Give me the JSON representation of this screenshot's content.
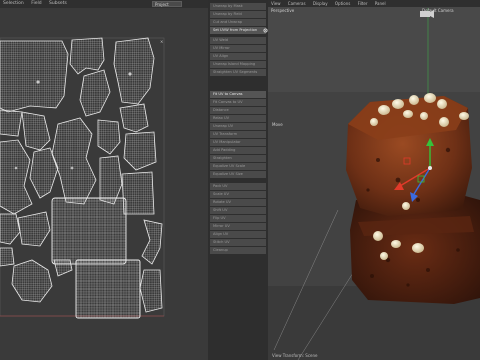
{
  "uv_editor": {
    "menu": [
      "Selection",
      "Field",
      "Subsets"
    ],
    "dropdown": "Project"
  },
  "commands": [
    {
      "label": "Unwrap by Mask",
      "state": "dim"
    },
    {
      "label": "Unwrap by Field",
      "state": "dim"
    },
    {
      "label": "Cut and Unwrap",
      "state": "dim"
    },
    {
      "label": "Set UVW from Projection",
      "state": "bright"
    },
    {
      "label": "UV Weld",
      "state": "dim"
    },
    {
      "label": "UV Mirror",
      "state": "dim"
    },
    {
      "label": "UV Align",
      "state": "dim"
    },
    {
      "label": "Unwrap Island Mapping",
      "state": "dim"
    },
    {
      "label": "Straighten UV Segments",
      "state": "dim"
    },
    {
      "label": "Fit UV to Canvas",
      "state": "bright"
    },
    {
      "label": "Fit Canvas to UV",
      "state": "dim"
    },
    {
      "label": "Distance",
      "state": "dim"
    },
    {
      "label": "Relax UV",
      "state": "dim"
    },
    {
      "label": "Unwrap UV",
      "state": "dim"
    },
    {
      "label": "UV Transform",
      "state": "dim"
    },
    {
      "label": "UV Manipulator",
      "state": "dim"
    },
    {
      "label": "Add Padding",
      "state": "dim"
    },
    {
      "label": "Straighten",
      "state": "dim"
    },
    {
      "label": "Equalize UV Scale",
      "state": "dim"
    },
    {
      "label": "Equalize UV Size",
      "state": "dim"
    },
    {
      "label": "Pack UV",
      "state": "dim"
    },
    {
      "label": "Scale UV",
      "state": "dim"
    },
    {
      "label": "Rotate UV",
      "state": "dim"
    },
    {
      "label": "Shift UV",
      "state": "dim"
    },
    {
      "label": "Flip UV",
      "state": "dim"
    },
    {
      "label": "Mirror UV",
      "state": "dim"
    },
    {
      "label": "Align UV",
      "state": "dim"
    },
    {
      "label": "Stitch UV",
      "state": "dim"
    },
    {
      "label": "Cleanup",
      "state": "dim"
    }
  ],
  "viewport": {
    "menu": [
      "View",
      "Cameras",
      "Display",
      "Options",
      "Filter",
      "Panel"
    ],
    "view_name": "Perspective",
    "camera": "Default Camera",
    "tool": "Move",
    "footer": "View Transform: Scene"
  },
  "colors": {
    "uv_bg": "#3a3a3a",
    "island_stroke": "#e4e4e4",
    "viewport_bg": "#484848",
    "brownie": "#7a3a1c",
    "axis_x": "#e23a2a",
    "axis_y": "#36c23a",
    "axis_z": "#3a6ae0"
  }
}
